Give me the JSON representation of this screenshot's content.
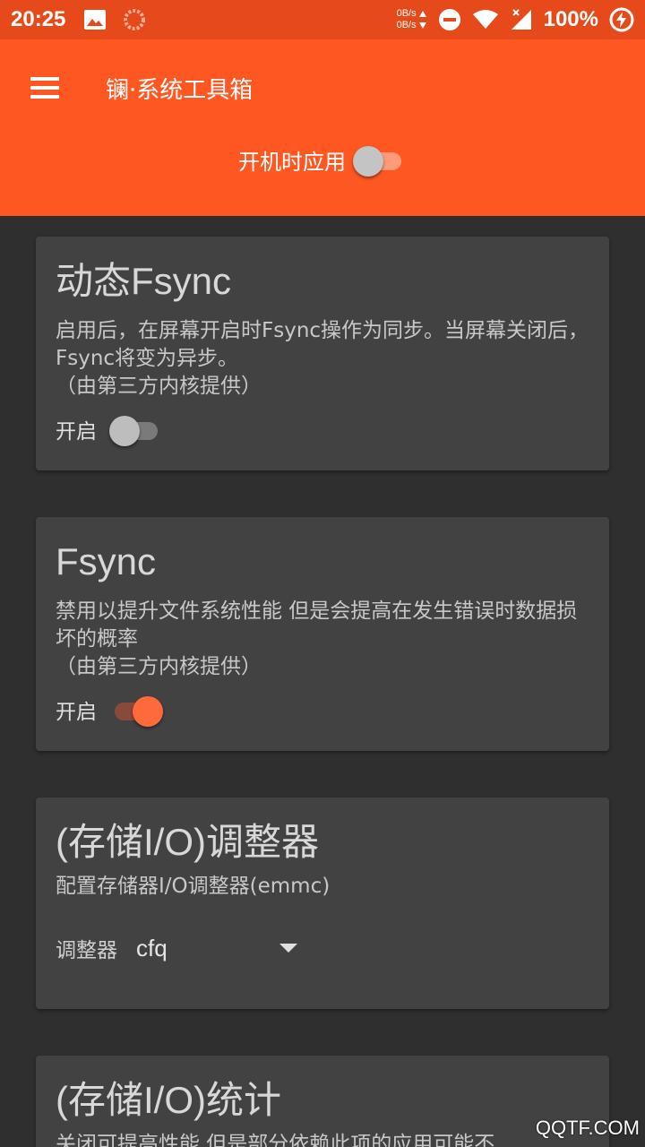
{
  "status_bar": {
    "time": "20:25",
    "speed_up": "0B/s",
    "speed_down": "0B/s",
    "battery": "100%",
    "icons": [
      "image-icon",
      "loading-icon",
      "data-arrows-icon",
      "dnd-icon",
      "wifi-icon",
      "signal-icon",
      "battery-charging-icon"
    ]
  },
  "app_bar": {
    "title": "镧·系统工具箱",
    "menu_icon": "hamburger-menu-icon",
    "boot_apply_label": "开机时应用",
    "boot_apply_on": false
  },
  "cards": [
    {
      "title": "动态Fsync",
      "description": "启用后，在屏幕开启时Fsync操作为同步。当屏幕关闭后，Fsync将变为异步。",
      "note": "（由第三方内核提供）",
      "toggle_label": "开启",
      "toggle_on": false
    },
    {
      "title": "Fsync",
      "description": "禁用以提升文件系统性能 但是会提高在发生错误时数据损坏的概率",
      "note": "（由第三方内核提供）",
      "toggle_label": "开启",
      "toggle_on": true
    },
    {
      "title": "(存储I/O)调整器",
      "description": "配置存储器I/O调整器(emmc)",
      "select_label": "调整器",
      "select_value": "cfq"
    },
    {
      "title": "(存储I/O)统计",
      "description": "关闭可提高性能 但是部分依赖此项的应用可能不"
    }
  ],
  "watermark": "QQTF.COM",
  "colors": {
    "status_bar": "#e6491a",
    "app_bar": "#ff5722",
    "background": "#2f2f2f",
    "card": "#424242",
    "accent": "#ff6a3d"
  }
}
